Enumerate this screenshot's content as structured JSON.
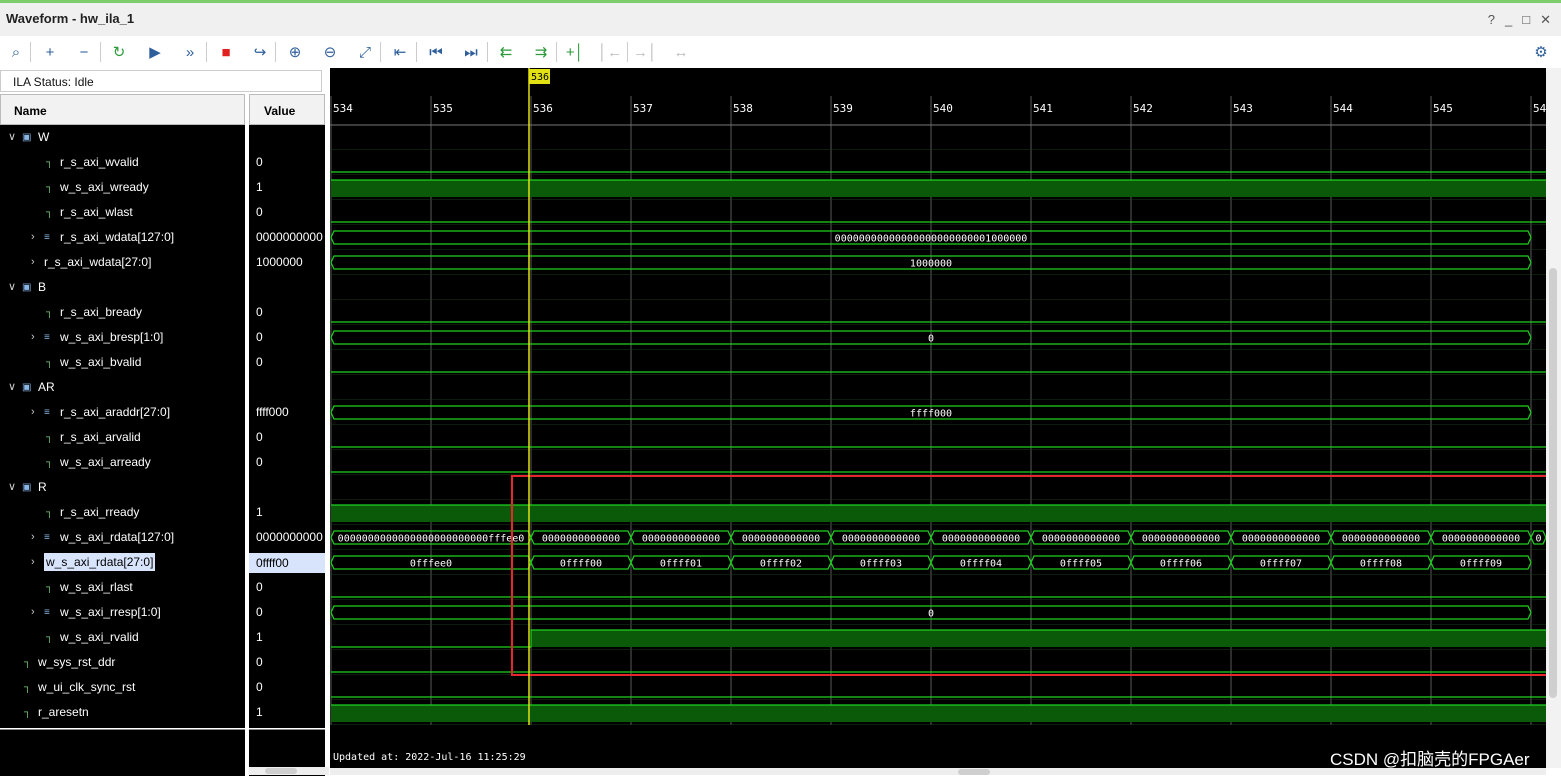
{
  "window": {
    "title": "Waveform - hw_ila_1",
    "controls": [
      "?",
      "_",
      "□",
      "✕"
    ]
  },
  "toolbar": {
    "buttons": [
      {
        "name": "search-icon",
        "glyph": "⌕"
      },
      {
        "name": "add-icon",
        "glyph": "+"
      },
      {
        "name": "remove-icon",
        "glyph": "−"
      },
      {
        "name": "run-trigger-immediate-icon",
        "glyph": "↻"
      },
      {
        "name": "run-trigger-icon",
        "glyph": "▶"
      },
      {
        "name": "run-immediate-icon",
        "glyph": "»"
      },
      {
        "name": "stop-icon",
        "glyph": "■"
      },
      {
        "name": "export-icon",
        "glyph": "↪"
      },
      {
        "name": "zoom-in-icon",
        "glyph": "⊕"
      },
      {
        "name": "zoom-out-icon",
        "glyph": "⊖"
      },
      {
        "name": "zoom-fit-icon",
        "glyph": "⤢"
      },
      {
        "name": "cursor-to-icon",
        "glyph": "⇤"
      },
      {
        "name": "go-to-start-icon",
        "glyph": "⏮"
      },
      {
        "name": "go-to-end-icon",
        "glyph": "⏭"
      },
      {
        "name": "previous-transition-icon",
        "glyph": "⇇"
      },
      {
        "name": "next-transition-icon",
        "glyph": "⇉"
      },
      {
        "name": "add-marker-icon",
        "glyph": "+│"
      },
      {
        "name": "previous-marker-icon",
        "glyph": "│←"
      },
      {
        "name": "next-marker-icon",
        "glyph": "→│"
      },
      {
        "name": "swap-markers-icon",
        "glyph": "↔"
      }
    ],
    "settings_icon": "⚙"
  },
  "ila_status": "ILA Status: Idle",
  "columns": {
    "name": "Name",
    "value": "Value"
  },
  "signals": [
    {
      "label": "W",
      "value": "",
      "kind": "group",
      "indent": 0,
      "expanded": true
    },
    {
      "label": "r_s_axi_wvalid",
      "value": "0",
      "kind": "bit",
      "indent": 2
    },
    {
      "label": "w_s_axi_wready",
      "value": "1",
      "kind": "bit",
      "indent": 2
    },
    {
      "label": "r_s_axi_wlast",
      "value": "0",
      "kind": "bit",
      "indent": 2
    },
    {
      "label": "r_s_axi_wdata[127:0]",
      "value": "0000000000",
      "kind": "bus",
      "indent": 2,
      "expander": true
    },
    {
      "label": "r_s_axi_wdata[27:0]",
      "value": "1000000",
      "kind": "plain",
      "indent": 2,
      "expander": true
    },
    {
      "label": "B",
      "value": "",
      "kind": "group",
      "indent": 0,
      "expanded": true
    },
    {
      "label": "r_s_axi_bready",
      "value": "0",
      "kind": "bit",
      "indent": 2
    },
    {
      "label": "w_s_axi_bresp[1:0]",
      "value": "0",
      "kind": "bus",
      "indent": 2,
      "expander": true
    },
    {
      "label": "w_s_axi_bvalid",
      "value": "0",
      "kind": "bit",
      "indent": 2
    },
    {
      "label": "AR",
      "value": "",
      "kind": "group",
      "indent": 0,
      "expanded": true
    },
    {
      "label": "r_s_axi_araddr[27:0]",
      "value": "ffff000",
      "kind": "bus",
      "indent": 2,
      "expander": true
    },
    {
      "label": "r_s_axi_arvalid",
      "value": "0",
      "kind": "bit",
      "indent": 2
    },
    {
      "label": "w_s_axi_arready",
      "value": "0",
      "kind": "bit",
      "indent": 2
    },
    {
      "label": "R",
      "value": "",
      "kind": "group",
      "indent": 0,
      "expanded": true
    },
    {
      "label": "r_s_axi_rready",
      "value": "1",
      "kind": "bit",
      "indent": 2
    },
    {
      "label": "w_s_axi_rdata[127:0]",
      "value": "0000000000",
      "kind": "bus",
      "indent": 2,
      "expander": true
    },
    {
      "label": "w_s_axi_rdata[27:0]",
      "value": "0ffff00",
      "kind": "plain",
      "indent": 1,
      "expander": true,
      "selected": true
    },
    {
      "label": "w_s_axi_rlast",
      "value": "0",
      "kind": "bit",
      "indent": 2
    },
    {
      "label": "w_s_axi_rresp[1:0]",
      "value": "0",
      "kind": "bus",
      "indent": 2,
      "expander": true
    },
    {
      "label": "w_s_axi_rvalid",
      "value": "1",
      "kind": "bit",
      "indent": 2
    },
    {
      "label": "w_sys_rst_ddr",
      "value": "0",
      "kind": "bit",
      "indent": 0
    },
    {
      "label": "w_ui_clk_sync_rst",
      "value": "0",
      "kind": "bit",
      "indent": 0
    },
    {
      "label": "r_aresetn",
      "value": "1",
      "kind": "bit",
      "indent": 0
    }
  ],
  "waveform": {
    "time_labels": [
      "534",
      "535",
      "536",
      "537",
      "538",
      "539",
      "540",
      "541",
      "542",
      "543",
      "544",
      "545",
      "54"
    ],
    "cursor_label": "536",
    "cursor_time": 535.98,
    "bit_traces": {
      "1": [
        [
          534,
          0
        ]
      ],
      "2": [
        [
          534,
          1
        ]
      ],
      "3": [
        [
          534,
          0
        ]
      ],
      "7": [
        [
          534,
          0
        ]
      ],
      "9": [
        [
          534,
          0
        ]
      ],
      "12": [
        [
          534,
          0
        ]
      ],
      "13": [
        [
          534,
          0
        ]
      ],
      "15": [
        [
          534,
          1
        ]
      ],
      "18": [
        [
          534,
          0
        ]
      ],
      "20": [
        [
          534,
          0
        ],
        [
          536,
          1
        ]
      ],
      "21": [
        [
          534,
          0
        ]
      ],
      "22": [
        [
          534,
          0
        ]
      ],
      "23": [
        [
          534,
          1
        ]
      ]
    },
    "bus_traces": {
      "4": [
        {
          "from": 534,
          "to": 546,
          "value": "00000000000000000000000001000000"
        }
      ],
      "5": [
        {
          "from": 534,
          "to": 546,
          "value": "1000000"
        }
      ],
      "8": [
        {
          "from": 534,
          "to": 546,
          "value": "0"
        }
      ],
      "11": [
        {
          "from": 534,
          "to": 546,
          "value": "ffff000"
        }
      ],
      "16": [
        {
          "from": 534,
          "to": 536,
          "value": "0000000000000000000000000fffee0"
        },
        {
          "from": 536,
          "to": 537,
          "value": "0000000000000"
        },
        {
          "from": 537,
          "to": 538,
          "value": "0000000000000"
        },
        {
          "from": 538,
          "to": 539,
          "value": "0000000000000"
        },
        {
          "from": 539,
          "to": 540,
          "value": "0000000000000"
        },
        {
          "from": 540,
          "to": 541,
          "value": "0000000000000"
        },
        {
          "from": 541,
          "to": 542,
          "value": "0000000000000"
        },
        {
          "from": 542,
          "to": 543,
          "value": "0000000000000"
        },
        {
          "from": 543,
          "to": 544,
          "value": "0000000000000"
        },
        {
          "from": 544,
          "to": 545,
          "value": "0000000000000"
        },
        {
          "from": 545,
          "to": 546,
          "value": "0000000000000"
        },
        {
          "from": 546,
          "to": 547,
          "value": "0"
        }
      ],
      "17": [
        {
          "from": 534,
          "to": 536,
          "value": "0fffee0"
        },
        {
          "from": 536,
          "to": 537,
          "value": "0ffff00"
        },
        {
          "from": 537,
          "to": 538,
          "value": "0ffff01"
        },
        {
          "from": 538,
          "to": 539,
          "value": "0ffff02"
        },
        {
          "from": 539,
          "to": 540,
          "value": "0ffff03"
        },
        {
          "from": 540,
          "to": 541,
          "value": "0ffff04"
        },
        {
          "from": 541,
          "to": 542,
          "value": "0ffff05"
        },
        {
          "from": 542,
          "to": 543,
          "value": "0ffff06"
        },
        {
          "from": 543,
          "to": 544,
          "value": "0ffff07"
        },
        {
          "from": 544,
          "to": 545,
          "value": "0ffff08"
        },
        {
          "from": 545,
          "to": 546,
          "value": "0ffff09"
        }
      ],
      "19": [
        {
          "from": 534,
          "to": 546,
          "value": "0"
        }
      ]
    },
    "updated_at": "Updated at: 2022-Jul-16 11:25:29",
    "highlight_box": {
      "from_time": 535.81,
      "to_time": 546.27,
      "from_row": 14,
      "to_row": 21
    },
    "colors": {
      "wave": "#1fd21f",
      "fill": "#0a5a0a",
      "cursor": "#e1e114",
      "grid": "#5a5a5a",
      "highlight": "#e8262d",
      "text": "#ffffff"
    }
  },
  "watermark": "CSDN @扣脑壳的FPGAer"
}
